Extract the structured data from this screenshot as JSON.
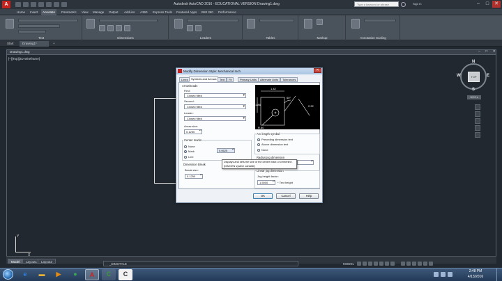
{
  "app": {
    "logo_letter": "A",
    "title": "Autodesk AutoCAD 2016 - EDUCATIONAL VERSION    Drawing1.dwg",
    "search_placeholder": "Type a keyword or phrase",
    "sign_in": "Sign In",
    "win_min": "–",
    "win_max": "□",
    "win_close": "✕"
  },
  "ribbon": {
    "tabs": [
      "Home",
      "Insert",
      "Annotate",
      "Parametric",
      "View",
      "Manage",
      "Output",
      "Add-ins",
      "A360",
      "Express Tools",
      "Featured Apps",
      "BIM 360",
      "Performance"
    ],
    "active_tab": "Annotate",
    "panels": [
      "Text",
      "Dimensions",
      "Leaders",
      "Tables",
      "Markup",
      "Annotation Scaling"
    ]
  },
  "file_tabs": {
    "start": "Start",
    "drawing": "Drawing1*",
    "add": "+"
  },
  "drawing": {
    "window_title": "Drawing1.dwg",
    "window_buttons": "– □ ✕",
    "view_label": "[–][Top][2D Wireframe]"
  },
  "viewcube": {
    "face": "TOP",
    "north": "N",
    "south": "S",
    "east": "E",
    "west": "W",
    "wcs": "WCS ▾"
  },
  "ucs": {
    "x": "X",
    "y": "Y"
  },
  "layout_tabs": [
    "Model",
    "Layout1",
    "Layout2"
  ],
  "command_line": "_DIMSTYLE",
  "status": {
    "model": "MODEL"
  },
  "taskbar": {
    "time": "2:48 PM",
    "date": "4/13/2016",
    "apps": [
      {
        "name": "internet-explorer",
        "glyph": "e",
        "color": "#2f7fd6"
      },
      {
        "name": "file-explorer",
        "glyph": "▬",
        "color": "#e4b03a"
      },
      {
        "name": "media-player",
        "glyph": "▶",
        "color": "#e58a12"
      },
      {
        "name": "chrome",
        "glyph": "●",
        "color": "#3aa757"
      },
      {
        "name": "autocad",
        "glyph": "A",
        "color": "#c8221f"
      },
      {
        "name": "camtasia-recorder",
        "glyph": "C",
        "color": "#3b9a3b"
      },
      {
        "name": "camtasia-studio",
        "glyph": "C",
        "color": "#2c2c2c"
      }
    ]
  },
  "dialog": {
    "title": "Modify Dimension Style: Mechanical Inch",
    "close": "✕",
    "tabs": [
      "Lines",
      "Symbols and Arrows",
      "Text",
      "Fit",
      "Primary Units",
      "Alternate Units",
      "Tolerances"
    ],
    "active_tab": "Symbols and Arrows",
    "arrowheads": {
      "group": "Arrowheads",
      "first_label": "First:",
      "first_value": "Closed filled",
      "second_label": "Second:",
      "second_value": "Closed filled",
      "leader_label": "Leader:",
      "leader_value": "Closed filled",
      "arrow_size_label": "Arrow size:",
      "arrow_size_value": "0.1250"
    },
    "center_marks": {
      "group": "Center marks",
      "options": [
        "None",
        "Mark",
        "Line"
      ],
      "selected": "Mark",
      "size_value": "0.0625"
    },
    "dimension_break": {
      "group": "Dimension Break",
      "break_size_label": "Break size:",
      "break_size_value": "0.1250"
    },
    "arc_length": {
      "group": "Arc length symbol",
      "options": [
        "Preceding dimension text",
        "Above dimension text",
        "None"
      ],
      "selected": "Preceding dimension text"
    },
    "radius_jog": {
      "group": "Radius jog dimension"
    },
    "linear_jog": {
      "group": "Linear jog dimension",
      "height_factor_label": "Jog height factor:",
      "height_factor_value": "1.5000",
      "times_text_height": "* Text height"
    },
    "preview": {
      "dim_top": "1.42",
      "dim_left": "1.86",
      "dim_right": "2.22",
      "dim_angle": "60°",
      "dim_radius": "R.80"
    },
    "tooltip": {
      "line1": "Displays and sets the size of the center mark or centerline.",
      "line2": "(DIMCEN system variable)"
    },
    "buttons": {
      "ok": "OK",
      "cancel": "Cancel",
      "help": "Help"
    }
  }
}
